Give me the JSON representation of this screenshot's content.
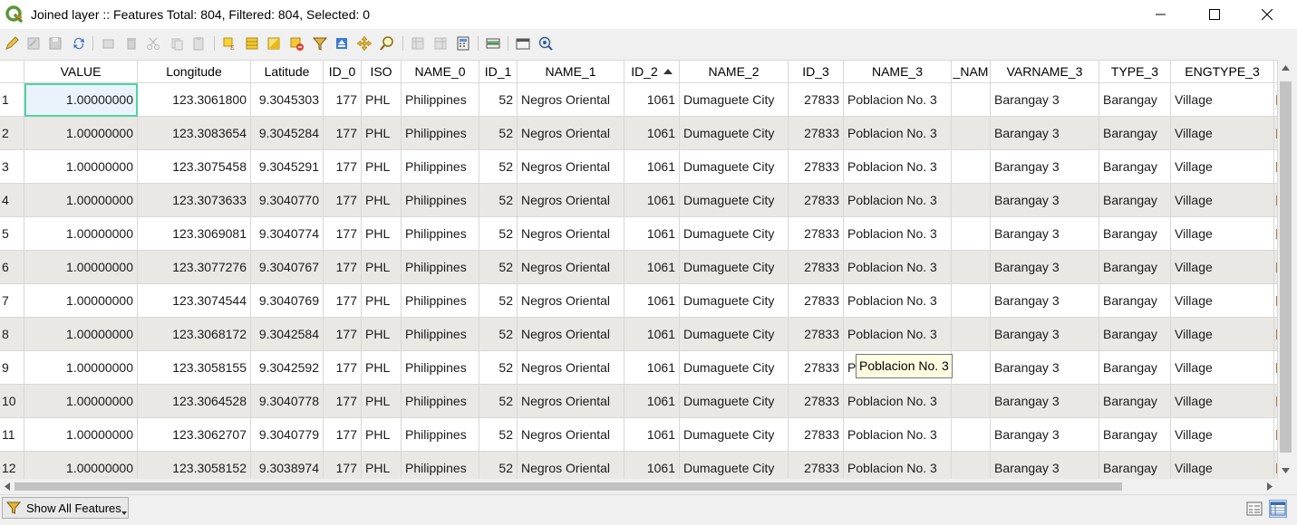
{
  "window": {
    "title": "Joined layer :: Features Total: 804, Filtered: 804, Selected: 0"
  },
  "toolbar": {
    "icons": [
      "pencil-icon",
      "save-edits-icon",
      "save-icon",
      "reload-icon",
      "add-feature-icon",
      "delete-feature-icon",
      "cut-icon",
      "copy-icon",
      "paste-icon",
      "expression-select-icon",
      "select-all-icon",
      "invert-selection-icon",
      "deselect-icon",
      "filter-icon",
      "move-selection-top-icon",
      "pan-to-selection-icon",
      "zoom-to-selection-icon",
      "new-field-icon",
      "delete-field-icon",
      "field-calculator-icon",
      "conditional-format-icon",
      "dock-icon",
      "actions-icon"
    ]
  },
  "table": {
    "columns": [
      "VALUE",
      "Longitude",
      "Latitude",
      "ID_0",
      "ISO",
      "NAME_0",
      "ID_1",
      "NAME_1",
      "ID_2",
      "NAME_2",
      "ID_3",
      "NAME_3",
      "_NAM",
      "VARNAME_3",
      "TYPE_3",
      "ENGTYPE_3"
    ],
    "sorted_column": "ID_2",
    "sort_direction": "ascending",
    "rows": [
      {
        "n": "1",
        "c": [
          "1.00000000",
          "123.3061800",
          "9.3045303",
          "177",
          "PHL",
          "Philippines",
          "52",
          "Negros Oriental",
          "1061",
          "Dumaguete City",
          "27833",
          "Poblacion No. 3",
          "",
          "Barangay 3",
          "Barangay",
          "Village"
        ]
      },
      {
        "n": "2",
        "c": [
          "1.00000000",
          "123.3083654",
          "9.3045284",
          "177",
          "PHL",
          "Philippines",
          "52",
          "Negros Oriental",
          "1061",
          "Dumaguete City",
          "27833",
          "Poblacion No. 3",
          "",
          "Barangay 3",
          "Barangay",
          "Village"
        ]
      },
      {
        "n": "3",
        "c": [
          "1.00000000",
          "123.3075458",
          "9.3045291",
          "177",
          "PHL",
          "Philippines",
          "52",
          "Negros Oriental",
          "1061",
          "Dumaguete City",
          "27833",
          "Poblacion No. 3",
          "",
          "Barangay 3",
          "Barangay",
          "Village"
        ]
      },
      {
        "n": "4",
        "c": [
          "1.00000000",
          "123.3073633",
          "9.3040770",
          "177",
          "PHL",
          "Philippines",
          "52",
          "Negros Oriental",
          "1061",
          "Dumaguete City",
          "27833",
          "Poblacion No. 3",
          "",
          "Barangay 3",
          "Barangay",
          "Village"
        ]
      },
      {
        "n": "5",
        "c": [
          "1.00000000",
          "123.3069081",
          "9.3040774",
          "177",
          "PHL",
          "Philippines",
          "52",
          "Negros Oriental",
          "1061",
          "Dumaguete City",
          "27833",
          "Poblacion No. 3",
          "",
          "Barangay 3",
          "Barangay",
          "Village"
        ]
      },
      {
        "n": "6",
        "c": [
          "1.00000000",
          "123.3077276",
          "9.3040767",
          "177",
          "PHL",
          "Philippines",
          "52",
          "Negros Oriental",
          "1061",
          "Dumaguete City",
          "27833",
          "Poblacion No. 3",
          "",
          "Barangay 3",
          "Barangay",
          "Village"
        ]
      },
      {
        "n": "7",
        "c": [
          "1.00000000",
          "123.3074544",
          "9.3040769",
          "177",
          "PHL",
          "Philippines",
          "52",
          "Negros Oriental",
          "1061",
          "Dumaguete City",
          "27833",
          "Poblacion No. 3",
          "",
          "Barangay 3",
          "Barangay",
          "Village"
        ]
      },
      {
        "n": "8",
        "c": [
          "1.00000000",
          "123.3068172",
          "9.3042584",
          "177",
          "PHL",
          "Philippines",
          "52",
          "Negros Oriental",
          "1061",
          "Dumaguete City",
          "27833",
          "Poblacion No. 3",
          "",
          "Barangay 3",
          "Barangay",
          "Village"
        ]
      },
      {
        "n": "9",
        "c": [
          "1.00000000",
          "123.3058155",
          "9.3042592",
          "177",
          "PHL",
          "Philippines",
          "52",
          "Negros Oriental",
          "1061",
          "Dumaguete City",
          "27833",
          "Poblacion No. 3",
          "",
          "Barangay 3",
          "Barangay",
          "Village"
        ]
      },
      {
        "n": "10",
        "c": [
          "1.00000000",
          "123.3064528",
          "9.3040778",
          "177",
          "PHL",
          "Philippines",
          "52",
          "Negros Oriental",
          "1061",
          "Dumaguete City",
          "27833",
          "Poblacion No. 3",
          "",
          "Barangay 3",
          "Barangay",
          "Village"
        ]
      },
      {
        "n": "11",
        "c": [
          "1.00000000",
          "123.3062707",
          "9.3040779",
          "177",
          "PHL",
          "Philippines",
          "52",
          "Negros Oriental",
          "1061",
          "Dumaguete City",
          "27833",
          "Poblacion No. 3",
          "",
          "Barangay 3",
          "Barangay",
          "Village"
        ]
      },
      {
        "n": "12",
        "c": [
          "1.00000000",
          "123.3058152",
          "9.3038974",
          "177",
          "PHL",
          "Philippines",
          "52",
          "Negros Oriental",
          "1061",
          "Dumaguete City",
          "27833",
          "Poblacion No. 3",
          "",
          "Barangay 3",
          "Barangay",
          "Village"
        ]
      }
    ],
    "tooltip": "Poblacion No. 3",
    "selection_color": "#55d1a2"
  },
  "bottom": {
    "show_all_label": "Show All Features"
  }
}
